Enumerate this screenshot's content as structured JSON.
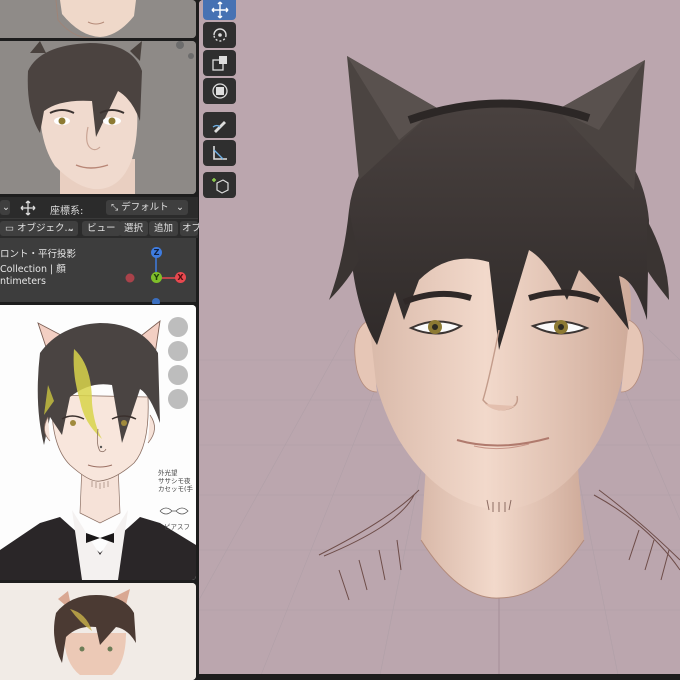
{
  "header": {
    "coord_system_label": "座標系:",
    "coord_system_value": "デフォルト"
  },
  "viewport_header": {
    "object_mode": "オブジェク...",
    "menu_view": "ビュー",
    "menu_select": "選択",
    "menu_add": "追加",
    "menu_object_partial": "オブ"
  },
  "small_viewport": {
    "view_line": "ロント・平行投影",
    "collection_line": "Collection | 顔",
    "unit_line": "ntimeters",
    "gizmo_z": "Z",
    "gizmo_y": "Y",
    "gizmo_x": "X"
  },
  "sketch_notes": {
    "note_line1": "外光望",
    "note_line2": "ササシモ夜",
    "note_line3": "カセッモ(手",
    "note_line4": "ピアスフ"
  },
  "toolbar": {
    "tools": [
      "move-icon",
      "rotate-icon",
      "scale-icon",
      "transform-icon",
      "annotate-icon",
      "measure-icon",
      "add-cube-icon"
    ],
    "active_tool": "move-icon"
  },
  "colors": {
    "viewport_bg": "#bba6ae",
    "active_tool": "#4772b3",
    "axis_x": "#e8484f",
    "axis_y": "#7fbf2a",
    "axis_z": "#3e7ce0"
  }
}
